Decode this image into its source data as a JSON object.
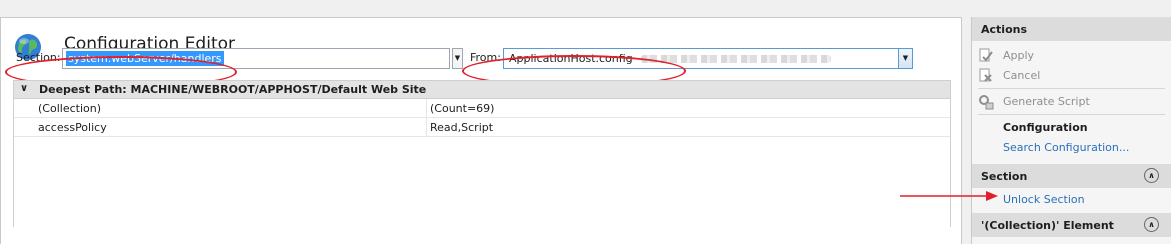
{
  "page": {
    "title": "Configuration Editor"
  },
  "section": {
    "label": "Section:",
    "value": "system.webServer/handlers"
  },
  "from": {
    "label": "From:",
    "value": "ApplicationHost.config"
  },
  "grid": {
    "path": "Deepest Path: MACHINE/WEBROOT/APPHOST/Default Web Site",
    "rows": [
      {
        "key": "(Collection)",
        "value": "(Count=69)"
      },
      {
        "key": "accessPolicy",
        "value": "Read,Script"
      }
    ]
  },
  "actions": {
    "header": "Actions",
    "apply": "Apply",
    "cancel": "Cancel",
    "generate_script": "Generate Script",
    "configuration_heading": "Configuration",
    "search_configuration": "Search Configuration...",
    "section_header": "Section",
    "unlock_section": "Unlock Section",
    "collection_header": "'(Collection)' Element"
  },
  "colors": {
    "annotation": "#e0202a",
    "link": "#2a70b8",
    "selection": "#3399ff"
  },
  "icons": [
    "globe-icon",
    "apply-icon",
    "cancel-icon",
    "generate-script-icon",
    "chevron-down-icon",
    "collapse-up-icon",
    "red-arrow-icon"
  ]
}
